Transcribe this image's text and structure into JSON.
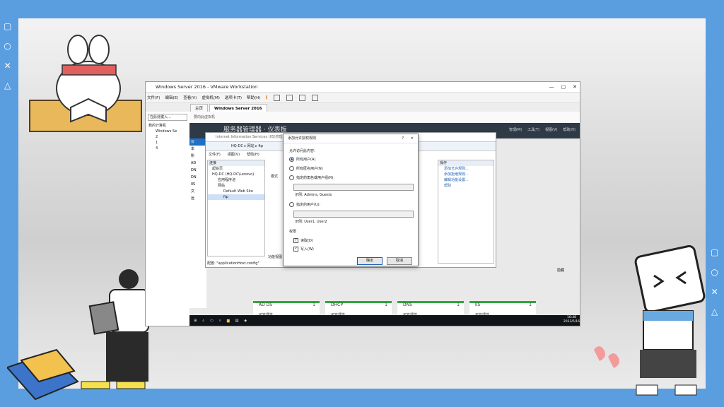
{
  "vm": {
    "title": "Windows Server 2016 - VMware Workstation",
    "menu": [
      "文件(F)",
      "编辑(E)",
      "查看(V)",
      "虚拟机(M)",
      "选项卡(T)",
      "帮助(H)"
    ],
    "tabs": [
      "主页",
      "Windows Server 2016"
    ],
    "hint": "要向此虚拟机",
    "library": {
      "search_placeholder": "在此处键入...",
      "root": "我的计算机",
      "items": [
        "Windows Se",
        "2",
        "1",
        "4"
      ]
    }
  },
  "server": {
    "header_title": "服务器管理器 · 仪表板",
    "header_menu": [
      "管理(M)",
      "工具(T)",
      "视图(V)",
      "帮助(H)"
    ],
    "left_items": [
      "仪",
      "本",
      "所",
      "AD",
      "DN",
      "DN",
      "IIS",
      "文",
      "远"
    ],
    "panel_label": "隐藏",
    "tiles": [
      {
        "name": "AD DS",
        "count": "1",
        "rows": [
          "可管理性",
          "事件",
          "服务"
        ]
      },
      {
        "name": "DHCP",
        "count": "1",
        "rows": [
          "可管理性",
          "事件",
          "服务"
        ]
      },
      {
        "name": "DNS",
        "count": "1",
        "rows": [
          "可管理性",
          "事件",
          "服务"
        ]
      },
      {
        "name": "IIS",
        "count": "1",
        "rows": [
          "可管理性",
          "事件",
          "服务"
        ]
      }
    ]
  },
  "taskbar": {
    "time": "16:48",
    "date": "2023/5/16"
  },
  "iis": {
    "title": "Internet Information Services (IIS)管理器",
    "address": "HQ-DC ▸ 网站 ▸ ftp",
    "menu": [
      "文件(F)",
      "视图(V)",
      "帮助(H)"
    ],
    "connections_header": "连接",
    "tree": [
      "起始页",
      "HQ-DC (HQ-DC\\Lenovo)",
      "应用程序池",
      "网站",
      "Default Web Site",
      "ftp"
    ],
    "center_label": "模式",
    "actions_header": "操作",
    "actions": [
      "添加允许规则...",
      "添加拒绝规则...",
      "编辑功能设置...",
      "帮助"
    ],
    "status": "配置: \"applicationHost.config\"",
    "view_tab": "功能视图"
  },
  "dialog": {
    "title": "添加允许授权规则",
    "question": "?",
    "close": "✕",
    "section_access": "允许访问此内容:",
    "opt_all_users": "所有用户(A)",
    "opt_anonymous": "所有匿名用户(N)",
    "opt_roles": "指定的角色或用户组(R):",
    "roles_example": "示例: Admins, Guests",
    "opt_users": "指定的用户(U):",
    "users_example": "示例: User1, User2",
    "section_perms": "权限",
    "perm_read": "读取(D)",
    "perm_write": "写入(W)",
    "ok": "确定",
    "cancel": "取消"
  },
  "side_icons_left": [
    "▢",
    "○",
    "✕",
    "△"
  ],
  "side_icons_right": [
    "▢",
    "○",
    "✕",
    "△"
  ],
  "colors": {
    "border_blue": "#5a9ee0",
    "accent": "#1a5fb4",
    "tile_green": "#2fa83b"
  }
}
